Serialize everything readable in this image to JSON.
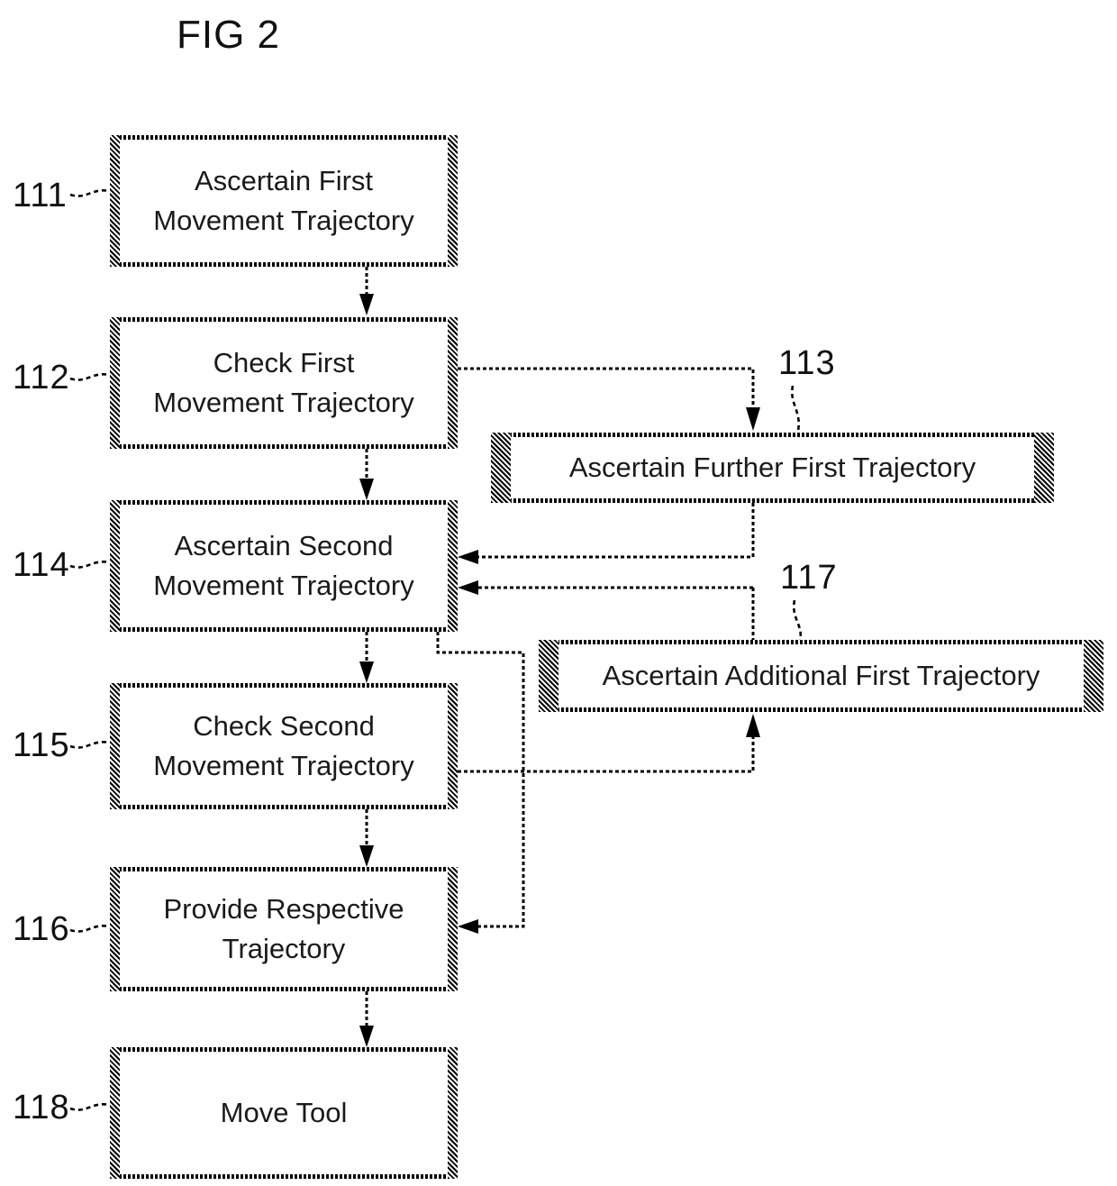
{
  "figure": {
    "title": "FIG 2",
    "type": "process-flow-diagram"
  },
  "boxes": [
    {
      "ref": "111",
      "label": "Ascertain First\nMovement Trajectory",
      "name": "step-111-ascertain-first-movement-trajectory"
    },
    {
      "ref": "112",
      "label": "Check First\nMovement Trajectory",
      "name": "step-112-check-first-movement-trajectory"
    },
    {
      "ref": "113",
      "label": "Ascertain Further First  Trajectory",
      "name": "step-113-ascertain-further-first-trajectory"
    },
    {
      "ref": "114",
      "label": "Ascertain Second\nMovement Trajectory",
      "name": "step-114-ascertain-second-movement-trajectory"
    },
    {
      "ref": "115",
      "label": "Check Second\nMovement Trajectory",
      "name": "step-115-check-second-movement-trajectory"
    },
    {
      "ref": "116",
      "label": "Provide Respective\nTrajectory",
      "name": "step-116-provide-respective-trajectory"
    },
    {
      "ref": "117",
      "label": "Ascertain Additional First  Trajectory",
      "name": "step-117-ascertain-additional-first-trajectory"
    },
    {
      "ref": "118",
      "label": "Move Tool",
      "name": "step-118-move-tool"
    }
  ],
  "refnums": {
    "r111": "111",
    "r112": "112",
    "r113": "113",
    "r114": "114",
    "r115": "115",
    "r116": "116",
    "r117": "117",
    "r118": "118"
  },
  "colors": {
    "ink": "#000000",
    "paper": "#ffffff"
  }
}
